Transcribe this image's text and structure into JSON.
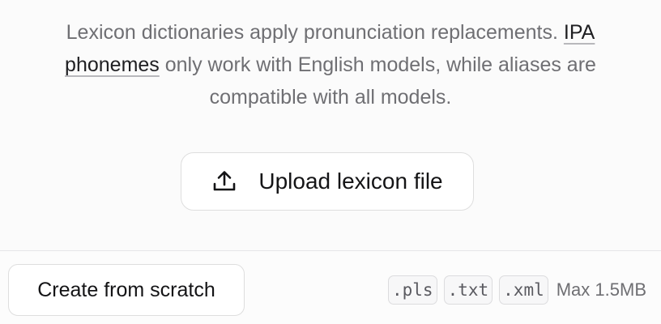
{
  "description": {
    "text_before": "Lexicon dictionaries apply pronunciation replacements.",
    "link_label": "IPA phonemes",
    "text_after": "only work with English models, while aliases are compatible with all models."
  },
  "upload": {
    "icon": "upload-icon",
    "label": "Upload lexicon file"
  },
  "footer": {
    "create_label": "Create from scratch",
    "formats": [
      ".pls",
      ".txt",
      ".xml"
    ],
    "max_size": "Max 1.5MB"
  }
}
